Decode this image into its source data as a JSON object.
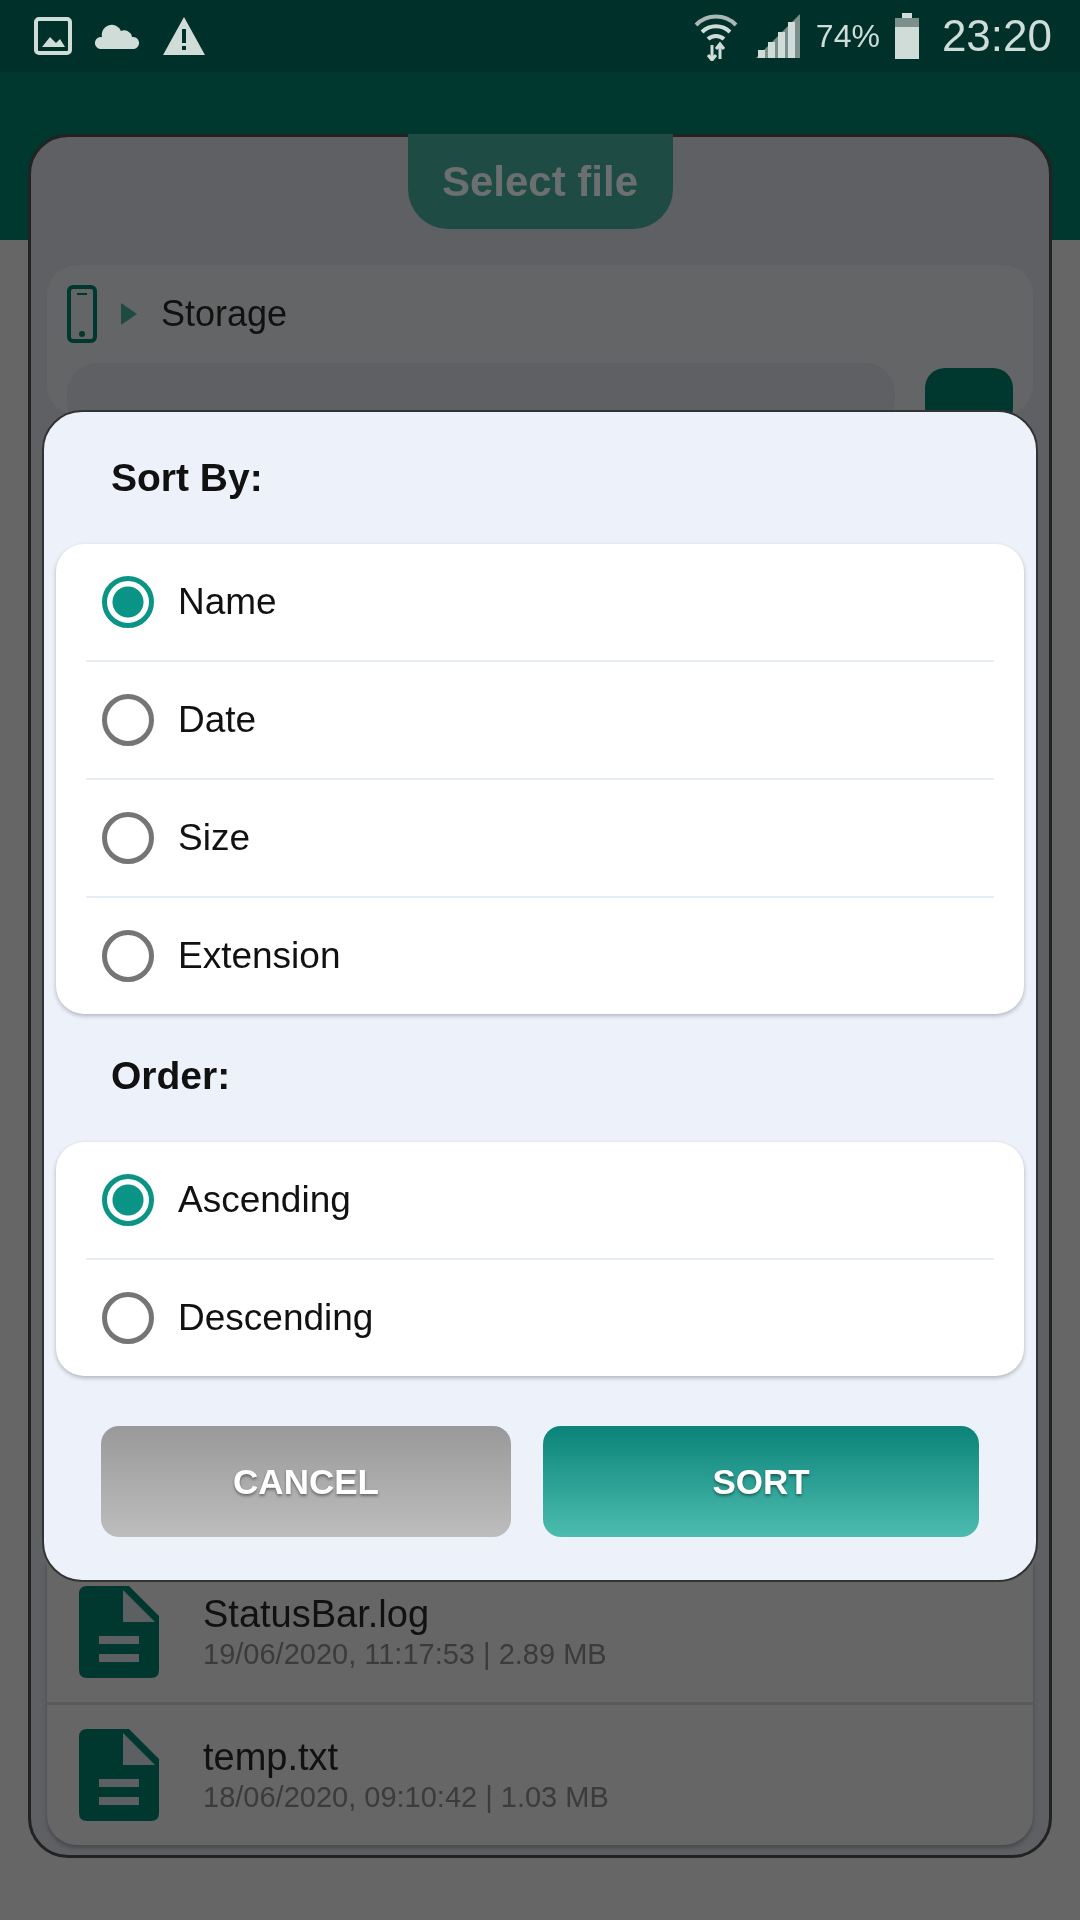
{
  "status_bar": {
    "battery": "74%",
    "time": "23:20"
  },
  "panel": {
    "title": "Select file",
    "breadcrumb": "Storage"
  },
  "files": [
    {
      "name": "StatusBar.log",
      "details": "19/06/2020, 11:17:53 | 2.89 MB"
    },
    {
      "name": "temp.txt",
      "details": "18/06/2020, 09:10:42 | 1.03 MB"
    }
  ],
  "dialog": {
    "sort_title": "Sort By:",
    "sort_options": [
      {
        "label": "Name",
        "selected": true
      },
      {
        "label": "Date",
        "selected": false
      },
      {
        "label": "Size",
        "selected": false
      },
      {
        "label": "Extension",
        "selected": false
      }
    ],
    "order_title": "Order:",
    "order_options": [
      {
        "label": "Ascending",
        "selected": true
      },
      {
        "label": "Descending",
        "selected": false
      }
    ],
    "buttons": [
      {
        "label": "CANCEL",
        "kind": "cancel"
      },
      {
        "label": "SORT",
        "kind": "confirm"
      }
    ]
  }
}
